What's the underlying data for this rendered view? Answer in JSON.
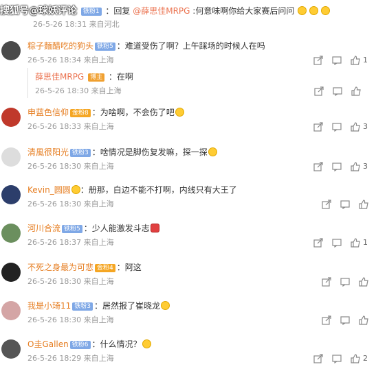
{
  "top": {
    "watermark": "搜狐号@球妖评论",
    "badge": "铁粉1",
    "reply_prefix": "：回复",
    "reply_target": "@薛思佳MRPG",
    "text": ":何意味啊你给大家赛后问问",
    "time": "26-5-26 18:31",
    "location": "来自河北"
  },
  "comments": [
    {
      "user": "粽子麵醋吃的狗头",
      "badge": "铁粉5",
      "badge_type": "fan",
      "text": "：难道受伤了啊？上午踩场的时候人在吗",
      "time": "26-5-26 18:34",
      "location": "来自上海",
      "likes": "1"
    },
    {
      "user": "申蓝色信仰",
      "badge": "金粉8",
      "badge_type": "gold",
      "text": "：为啥啊，不会伤了吧",
      "time": "26-5-26 18:33",
      "location": "来自上海",
      "likes": "3"
    },
    {
      "user": "清風很阳光",
      "badge": "铁粉3",
      "badge_type": "fan",
      "text": "：啥情况是脚伤复发嘛，探一探",
      "time": "26-5-26 18:30",
      "location": "来自上海",
      "likes": "3"
    },
    {
      "user": "Kevin_圆圆",
      "badge": "",
      "badge_type": "",
      "text": "：册那，白边不能不打啊，内线只有大王了",
      "time": "26-5-26 18:30",
      "location": "来自上海",
      "likes": ""
    },
    {
      "user": "河川合流",
      "badge": "铁粉5",
      "badge_type": "fan",
      "text": "：少人能激发斗志",
      "time": "26-5-26 18:37",
      "location": "来自上海",
      "likes": "1"
    },
    {
      "user": "不死之身最为可悲",
      "badge": "金粉4",
      "badge_type": "gold",
      "text": "：阿这",
      "time": "26-5-26 18:30",
      "location": "来自上海",
      "likes": ""
    },
    {
      "user": "我是小琦11",
      "badge": "铁粉3",
      "badge_type": "fan",
      "text": "：居然报了崔晓龙",
      "time": "26-5-26 18:30",
      "location": "来自上海",
      "likes": ""
    },
    {
      "user": "O圭Gallen",
      "badge": "铁粉6",
      "badge_type": "fan",
      "text": "：什么情况？",
      "time": "26-5-26 18:29",
      "location": "来自上海",
      "likes": "2"
    }
  ],
  "nested_reply": {
    "user": "薛思佳MRPG",
    "badge": "博主",
    "text": "：在啊",
    "time": "26-5-26 18:30",
    "location": "来自上海"
  },
  "icons": {
    "share": "share-icon",
    "comment": "comment-icon",
    "like": "like-icon"
  }
}
